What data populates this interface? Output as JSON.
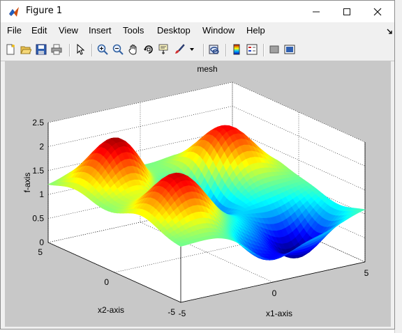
{
  "window": {
    "title": "Figure 1",
    "minimize_symbol": "—",
    "maximize_symbol": "☐",
    "close_symbol": "✕"
  },
  "menu": {
    "file": "File",
    "edit": "Edit",
    "view": "View",
    "insert": "Insert",
    "tools": "Tools",
    "desktop": "Desktop",
    "window": "Window",
    "help": "Help"
  },
  "toolbar": {
    "icons": [
      "new-figure-icon",
      "open-file-icon",
      "save-icon",
      "print-icon",
      "select-arrow-icon",
      "zoom-in-icon",
      "zoom-out-icon",
      "pan-hand-icon",
      "rotate-3d-icon",
      "data-cursor-icon",
      "brush-icon",
      "link-plot-icon",
      "colorbar-icon",
      "legend-icon",
      "hide-plot-tools-icon",
      "show-plot-tools-icon"
    ]
  },
  "plot": {
    "title": "mesh",
    "xlabel": "x1-axis",
    "ylabel": "x2-axis",
    "zlabel": "f-axis",
    "z_ticks": [
      "0",
      "0.5",
      "1",
      "1.5",
      "2",
      "2.5"
    ],
    "x1_ticks": [
      "-5",
      "0",
      "5"
    ],
    "x2_ticks": [
      "-5",
      "0",
      "5"
    ]
  },
  "chart_data": {
    "type": "mesh",
    "title": "mesh",
    "xlabel": "x1-axis",
    "ylabel": "x2-axis",
    "zlabel": "f-axis",
    "xlim": [
      -5,
      5
    ],
    "ylim": [
      -5,
      5
    ],
    "zlim": [
      0,
      2.5
    ],
    "grid": true,
    "colormap": "jet",
    "surface": "peaks at (±3, ±3)-ish, troughs near 0.1, values ranging approx 0.1 to 2.3"
  }
}
